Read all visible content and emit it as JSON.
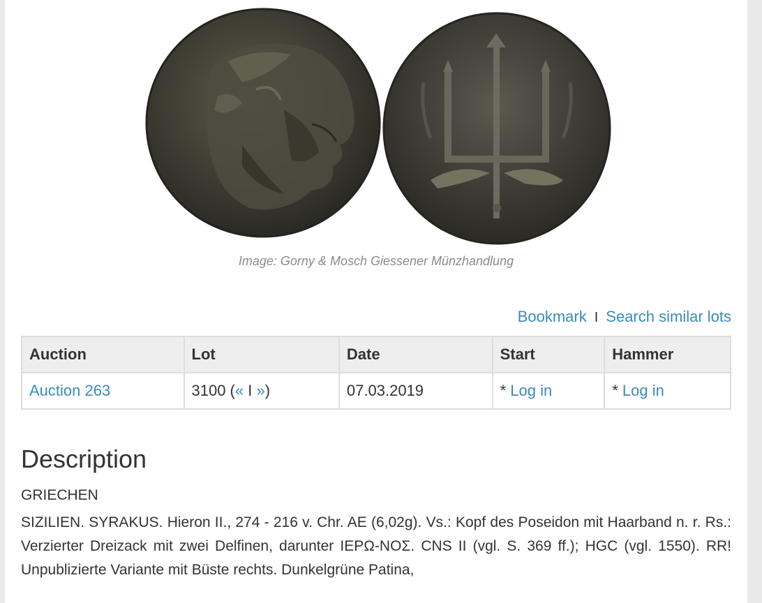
{
  "image": {
    "caption": "Image: Gorny & Mosch Giessener Münzhandlung"
  },
  "actions": {
    "bookmark": "Bookmark",
    "separator": "I",
    "search_similar": "Search similar lots"
  },
  "table": {
    "headers": [
      "Auction",
      "Lot",
      "Date",
      "Start",
      "Hammer"
    ],
    "row": {
      "auction": "Auction 263",
      "lot_number": "3100 (",
      "lot_prev": "«",
      "lot_sep": " I ",
      "lot_next": "»",
      "lot_close": ")",
      "date": "07.03.2019",
      "start_prefix": "* ",
      "start_link": "Log in",
      "hammer_prefix": "* ",
      "hammer_link": "Log in"
    }
  },
  "description": {
    "title": "Description",
    "category": "GRIECHEN",
    "text": "SIZILIEN. SYRAKUS. Hieron II., 274 - 216 v. Chr. AE (6,02g). Vs.: Kopf des Poseidon mit Haarband n. r. Rs.: Verzierter Dreizack mit zwei Delfinen, darunter ΙΕΡΩ-ΝΟΣ. CNS II  (vgl. S. 369 ff.); HGC  (vgl. 1550). RR! Unpublizierte Variante mit Büste rechts. Dunkelgrüne Patina,"
  },
  "colors": {
    "link": "#3a8bbb",
    "text": "#333333",
    "caption": "#8a8a8a",
    "header_bg": "#eeeeee",
    "border": "#dddddd"
  }
}
